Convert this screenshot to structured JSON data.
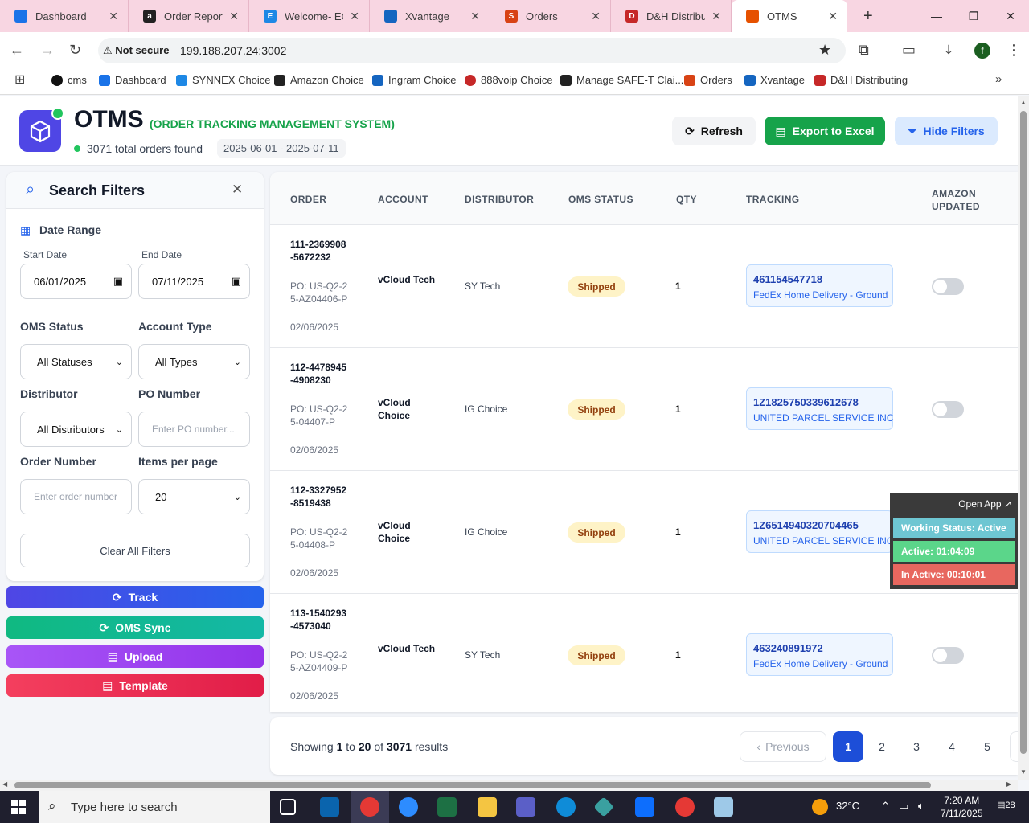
{
  "browser": {
    "tabs": [
      {
        "label": "Dashboard",
        "icon": "globe-icon",
        "color": "#1a73e8"
      },
      {
        "label": "Order Reports",
        "icon": "amazon-icon",
        "color": "#222222"
      },
      {
        "label": "Welcome- ECE",
        "icon": "ec-icon",
        "color": "#1e88e5"
      },
      {
        "label": "Xvantage",
        "icon": "xvantage-icon",
        "color": "#1565c0"
      },
      {
        "label": "Orders",
        "icon": "orders-icon",
        "color": "#d84315"
      },
      {
        "label": "D&H Distribut",
        "icon": "dh-icon",
        "color": "#c62828"
      },
      {
        "label": "OTMS",
        "icon": "otms-icon",
        "color": "#e65100"
      }
    ],
    "new_tab": "+",
    "security": "Not secure",
    "url": "199.188.207.24:3002",
    "profile_initial": "f",
    "bookmarks": [
      {
        "label": "cms",
        "color": "#111111"
      },
      {
        "label": "Dashboard",
        "color": "#1a73e8"
      },
      {
        "label": "SYNNEX Choice",
        "color": "#1e88e5"
      },
      {
        "label": "Amazon Choice",
        "color": "#222222"
      },
      {
        "label": "Ingram Choice",
        "color": "#1565c0"
      },
      {
        "label": "888voip Choice",
        "color": "#c62828"
      },
      {
        "label": "Manage SAFE-T Clai...",
        "color": "#222222"
      },
      {
        "label": "Orders",
        "color": "#d84315"
      },
      {
        "label": "Xvantage",
        "color": "#1565c0"
      },
      {
        "label": "D&H Distributing",
        "color": "#c62828"
      }
    ]
  },
  "header": {
    "title": "OTMS",
    "subtitle": "(ORDER TRACKING MANAGEMENT SYSTEM)",
    "total": "3071 total orders found",
    "date_range": "2025-06-01 - 2025-07-11",
    "refresh": "Refresh",
    "export": "Export to Excel",
    "hide_filters": "Hide Filters"
  },
  "filters": {
    "title": "Search Filters",
    "date_range_label": "Date Range",
    "start_label": "Start Date",
    "start_value": "06/01/2025",
    "end_label": "End Date",
    "end_value": "07/11/2025",
    "oms_status_label": "OMS Status",
    "oms_status_value": "All Statuses",
    "account_type_label": "Account Type",
    "account_type_value": "All Types",
    "distributor_label": "Distributor",
    "distributor_value": "All Distributors",
    "po_label": "PO Number",
    "po_placeholder": "Enter PO number...",
    "order_label": "Order Number",
    "order_placeholder": "Enter order number",
    "per_page_label": "Items per page",
    "per_page_value": "20",
    "clear": "Clear All Filters"
  },
  "actions": {
    "track": "Track",
    "oms_sync": "OMS Sync",
    "upload": "Upload",
    "template": "Template"
  },
  "table": {
    "headers": {
      "order": "ORDER",
      "account": "ACCOUNT",
      "distributor": "DISTRIBUTOR",
      "oms_status": "OMS STATUS",
      "qty": "QTY",
      "tracking": "TRACKING",
      "amazon_updated": "AMAZON UPDATED"
    },
    "rows": [
      {
        "order": "111-2369908-5672232",
        "po": "PO: US-Q2-25-AZ04406-P",
        "date": "02/06/2025",
        "account": "vCloud Tech",
        "distributor": "SY Tech",
        "status": "Shipped",
        "qty": "1",
        "tracking": "461154547718",
        "carrier": "FedEx Home Delivery - Ground",
        "amazon_updated": false
      },
      {
        "order": "112-4478945-4908230",
        "po": "PO: US-Q2-25-04407-P",
        "date": "02/06/2025",
        "account": "vCloud Choice",
        "distributor": "IG Choice",
        "status": "Shipped",
        "qty": "1",
        "tracking": "1Z1825750339612678",
        "carrier": "UNITED PARCEL SERVICE INC",
        "amazon_updated": false
      },
      {
        "order": "112-3327952-8519438",
        "po": "PO: US-Q2-25-04408-P",
        "date": "02/06/2025",
        "account": "vCloud Choice",
        "distributor": "IG Choice",
        "status": "Shipped",
        "qty": "1",
        "tracking": "1Z6514940320704465",
        "carrier": "UNITED PARCEL SERVICE INC",
        "amazon_updated": false
      },
      {
        "order": "113-1540293-4573040",
        "po": "PO: US-Q2-25-AZ04409-P",
        "date": "02/06/2025",
        "account": "vCloud Tech",
        "distributor": "SY Tech",
        "status": "Shipped",
        "qty": "1",
        "tracking": "463240891972",
        "carrier": "FedEx Home Delivery - Ground",
        "amazon_updated": false
      }
    ]
  },
  "pagination": {
    "showing_prefix": "Showing",
    "from": "1",
    "to_word": "to",
    "to": "20",
    "of_word": "of",
    "total": "3071",
    "results_word": "results",
    "previous": "Previous",
    "pages": [
      "1",
      "2",
      "3",
      "4",
      "5"
    ],
    "current": "1"
  },
  "widget": {
    "open_app": "Open App ↗",
    "working": "Working Status: Active",
    "active": "Active: 01:04:09",
    "inactive": "In Active: 00:10:01"
  },
  "taskbar": {
    "search_placeholder": "Type here to search",
    "temperature": "32°C",
    "time": "7:20 AM",
    "date": "7/11/2025",
    "notifications": "28"
  }
}
